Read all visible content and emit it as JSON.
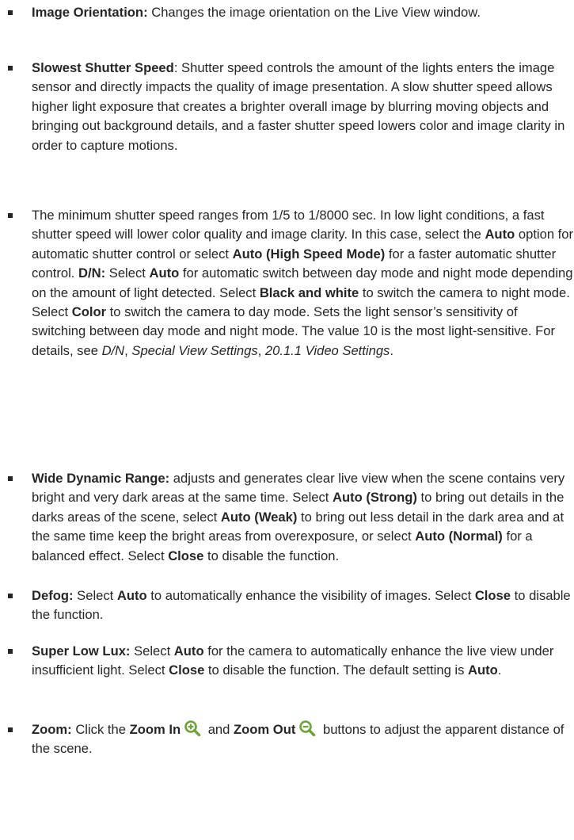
{
  "items": [
    {
      "id": "image-orientation",
      "parts": [
        {
          "t": "Image Orientation:",
          "s": "b"
        },
        {
          "t": "  Changes the image orientation on the Live View window."
        }
      ]
    },
    {
      "id": "slowest-shutter-speed",
      "parts": [
        {
          "t": "Slowest Shutter Speed",
          "s": "b"
        },
        {
          "t": ": Shutter speed controls the amount of the lights enters the image sensor and directly impacts the quality of image presentation. A slow shutter speed allows higher light exposure that creates a brighter overall image by blurring moving objects and bringing out background details, and a faster shutter speed lowers color and image clarity in order to capture motions."
        }
      ]
    },
    {
      "id": "minimum-shutter-speed",
      "parts": [
        {
          "t": "The minimum shutter speed ranges from 1/5 to 1/8000 sec. In low light conditions, a fast shutter speed will lower color quality and image clarity. In this case, select the "
        },
        {
          "t": "Auto",
          "s": "b"
        },
        {
          "t": " option for automatic shutter control or select "
        },
        {
          "t": "Auto (High Speed Mode)",
          "s": "b"
        },
        {
          "t": " for a faster automatic shutter control. "
        },
        {
          "t": "D/N:",
          "s": "b"
        },
        {
          "t": " Select "
        },
        {
          "t": "Auto",
          "s": "b"
        },
        {
          "t": " for automatic switch between day mode and night mode depending on the amount of light detected. Select "
        },
        {
          "t": "Black and white",
          "s": "b"
        },
        {
          "t": " to switch the camera to night mode. Select "
        },
        {
          "t": "Color",
          "s": "b"
        },
        {
          "t": " to switch the camera to day mode. Sets the light sensor’s sensitivity of switching between day mode and night mode. The value 10 is the most light-sensitive. For details, see "
        },
        {
          "t": "D/N",
          "s": "i"
        },
        {
          "t": ", "
        },
        {
          "t": "Special View Settings",
          "s": "i"
        },
        {
          "t": ", "
        },
        {
          "t": "20.1.1 Video Settings",
          "s": "i"
        },
        {
          "t": "."
        }
      ]
    },
    {
      "id": "wide-dynamic-range",
      "parts": [
        {
          "t": "Wide Dynamic Range:",
          "s": "b"
        },
        {
          "t": " adjusts and generates clear live view when the scene contains very bright and very dark areas at the same time. Select "
        },
        {
          "t": "Auto (Strong)",
          "s": "b"
        },
        {
          "t": " to bring out details in the darks areas of the scene, select "
        },
        {
          "t": "Auto (Weak)",
          "s": "b"
        },
        {
          "t": " to bring out less detail in the dark area and at the same time keep the bright areas from overexposure, or select "
        },
        {
          "t": "Auto (Normal)",
          "s": "b"
        },
        {
          "t": " for a balanced effect. Select "
        },
        {
          "t": "Close",
          "s": "b"
        },
        {
          "t": " to disable the function."
        }
      ]
    },
    {
      "id": "defog",
      "parts": [
        {
          "t": "Defog:",
          "s": "b"
        },
        {
          "t": " Select "
        },
        {
          "t": "Auto",
          "s": "b"
        },
        {
          "t": " to automatically enhance the visibility of images. Select "
        },
        {
          "t": "Close",
          "s": "b"
        },
        {
          "t": " to disable the function."
        }
      ]
    },
    {
      "id": "super-low-lux",
      "parts": [
        {
          "t": "Super Low Lux:",
          "s": "b"
        },
        {
          "t": " Select "
        },
        {
          "t": "Auto",
          "s": "b"
        },
        {
          "t": " for the camera to automatically enhance the live view under insufficient light. Select "
        },
        {
          "t": "Close",
          "s": "b"
        },
        {
          "t": " to disable the function. The default setting is "
        },
        {
          "t": "Auto",
          "s": "b"
        },
        {
          "t": "."
        }
      ]
    },
    {
      "id": "zoom",
      "parts": [
        {
          "t": "Zoom:",
          "s": "b"
        },
        {
          "t": " Click the "
        },
        {
          "t": "Zoom In",
          "s": "b"
        },
        {
          "icon": "zoom-in-icon"
        },
        {
          "t": " and "
        },
        {
          "t": "Zoom Out",
          "s": "b"
        },
        {
          "icon": "zoom-out-icon"
        },
        {
          "t": " buttons to adjust the apparent distance of the scene."
        }
      ]
    }
  ],
  "colors": {
    "text": "#262626",
    "icon": "#6ea23a"
  }
}
